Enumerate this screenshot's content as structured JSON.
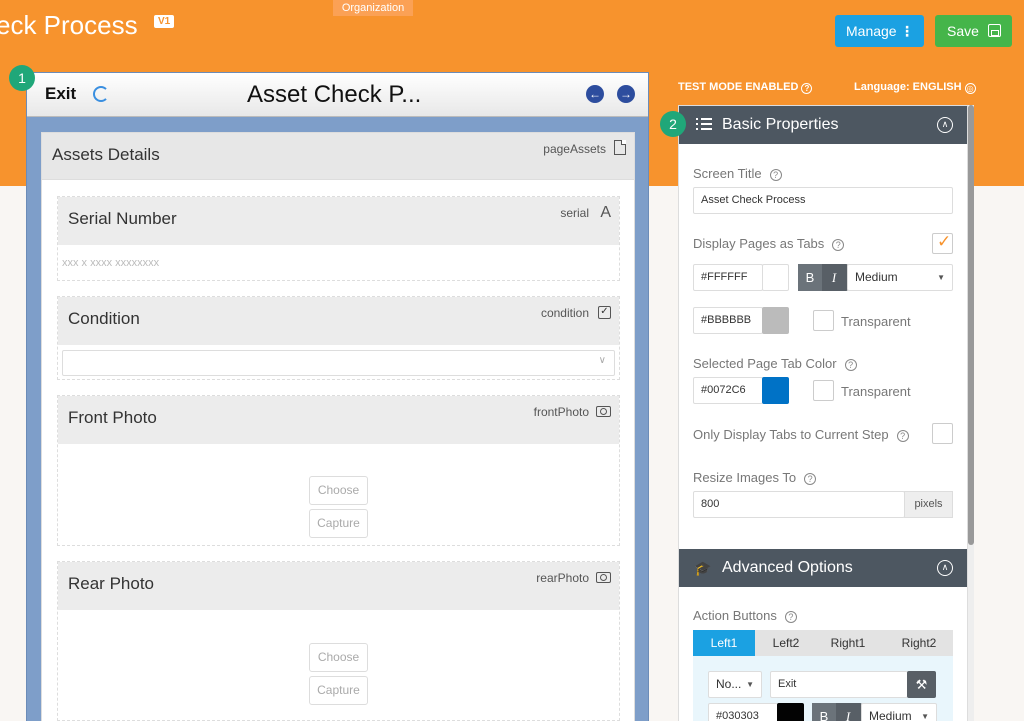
{
  "header": {
    "app_title": "eck Process",
    "version": "V1",
    "org": "Organization",
    "manage_label": "Manage",
    "save_label": "Save",
    "test_mode": "TEST MODE ENABLED",
    "language": "Language: ENGLISH"
  },
  "steps": {
    "one": "1",
    "two": "2"
  },
  "preview": {
    "exit_label": "Exit",
    "title": "Asset Check P...",
    "page": {
      "title": "Assets Details",
      "key": "pageAssets",
      "fields": [
        {
          "label": "Serial Number",
          "key": "serial",
          "placeholder": "xxx x xxxx xxxxxxxx"
        },
        {
          "label": "Condition",
          "key": "condition"
        },
        {
          "label": "Front Photo",
          "key": "frontPhoto",
          "choose": "Choose",
          "capture": "Capture"
        },
        {
          "label": "Rear Photo",
          "key": "rearPhoto",
          "choose": "Choose",
          "capture": "Capture"
        }
      ]
    }
  },
  "panel": {
    "basic_title": "Basic Properties",
    "screen_title_label": "Screen Title",
    "screen_title_value": "Asset Check Process",
    "display_tabs_label": "Display Pages as Tabs",
    "display_tabs_checked": true,
    "tab_text_color": "#FFFFFF",
    "bold": "B",
    "italic": "I",
    "font_size": "Medium",
    "tab_bg_color": "#BBBBBB",
    "transparent_label": "Transparent",
    "selected_tab_label": "Selected Page Tab Color",
    "selected_tab_color": "#0072C6",
    "only_current_label": "Only Display Tabs to Current Step",
    "resize_label": "Resize Images To",
    "resize_value": "800",
    "resize_unit": "pixels",
    "advanced_title": "Advanced Options",
    "action_buttons_label": "Action Buttons",
    "tabs": [
      "Left1",
      "Left2",
      "Right1",
      "Right2"
    ],
    "action_type": "No...",
    "action_label": "Exit",
    "action_color": "#030303",
    "action_font_size": "Medium"
  },
  "colors": {
    "accent": "#f7932d",
    "manage": "#1ba1e2",
    "save": "#45b54a",
    "swatch_white": "#FFFFFF",
    "swatch_gray": "#BBBBBB",
    "swatch_blue": "#0072C6",
    "swatch_black": "#030303"
  },
  "icons": [
    "kebab-icon",
    "save-disk-icon",
    "help-icon",
    "globe-icon",
    "refresh-icon",
    "arrow-left-icon",
    "arrow-right-icon",
    "document-icon",
    "text-icon",
    "checkbox-icon",
    "camera-icon",
    "chevron-down-icon",
    "list-icon",
    "chevron-up-icon",
    "graduation-cap-icon",
    "check-icon",
    "wrench-icon"
  ]
}
